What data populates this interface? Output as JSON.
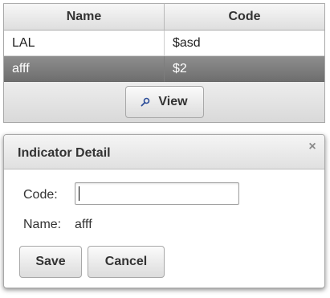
{
  "table": {
    "columns": [
      "Name",
      "Code"
    ],
    "rows": [
      {
        "name": "LAL",
        "code": "$asd",
        "selected": false
      },
      {
        "name": "afff",
        "code": "$2",
        "selected": true
      }
    ],
    "view_button": {
      "label": "View",
      "icon": "search-icon"
    }
  },
  "dialog": {
    "title": "Indicator Detail",
    "close_icon": "×",
    "code_label": "Code:",
    "code_value": "",
    "name_label": "Name:",
    "name_value": "afff",
    "save_label": "Save",
    "cancel_label": "Cancel"
  },
  "colors": {
    "selected_row": "#7a7a7a",
    "header_bg": "#e5e5e5"
  }
}
